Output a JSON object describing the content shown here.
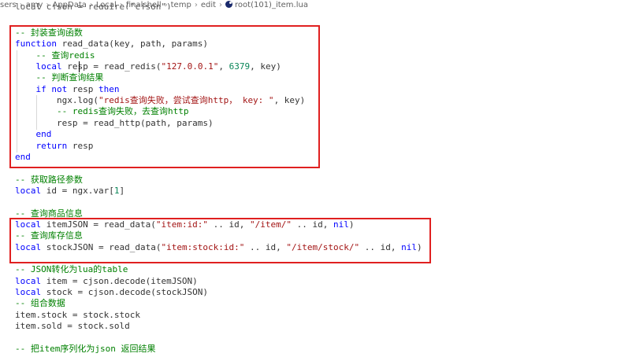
{
  "breadcrumb": {
    "items": [
      "sers",
      "amy",
      "AppData",
      "Local",
      "finalshell",
      "temp",
      "edit",
      "root(101)_item.lua"
    ],
    "file_icon": "lua-file-icon"
  },
  "editor": {
    "partial_top_line": "local cjson = require(\"cjson\")",
    "lines": [
      {
        "segments": [
          {
            "t": "-- 封装查询函数",
            "c": "c"
          }
        ]
      },
      {
        "segments": [
          {
            "t": "function",
            "c": "k"
          },
          {
            "t": " read_data(key, path, params)",
            "c": "p"
          }
        ]
      },
      {
        "segments": [
          {
            "t": "    -- 查询redis",
            "c": "c"
          }
        ]
      },
      {
        "segments": [
          {
            "t": "    ",
            "c": "p"
          },
          {
            "t": "local",
            "c": "k"
          },
          {
            "t": " resp = read_redis(",
            "c": "p"
          },
          {
            "t": "\"127.0.0.1\"",
            "c": "s"
          },
          {
            "t": ", ",
            "c": "p"
          },
          {
            "t": "6379",
            "c": "n"
          },
          {
            "t": ", key)",
            "c": "p"
          }
        ]
      },
      {
        "segments": [
          {
            "t": "    -- 判断查询结果",
            "c": "c"
          }
        ]
      },
      {
        "segments": [
          {
            "t": "    ",
            "c": "p"
          },
          {
            "t": "if not",
            "c": "k"
          },
          {
            "t": " resp ",
            "c": "p"
          },
          {
            "t": "then",
            "c": "k"
          }
        ]
      },
      {
        "segments": [
          {
            "t": "        ngx.log(",
            "c": "p"
          },
          {
            "t": "\"redis查询失败，尝试查询http， key: \"",
            "c": "s"
          },
          {
            "t": ", key)",
            "c": "p"
          }
        ]
      },
      {
        "segments": [
          {
            "t": "        -- redis查询失败，去查询http",
            "c": "c"
          }
        ]
      },
      {
        "segments": [
          {
            "t": "        resp = read_http(path, params)",
            "c": "p"
          }
        ]
      },
      {
        "segments": [
          {
            "t": "    ",
            "c": "p"
          },
          {
            "t": "end",
            "c": "k"
          }
        ]
      },
      {
        "segments": [
          {
            "t": "    ",
            "c": "p"
          },
          {
            "t": "return",
            "c": "k"
          },
          {
            "t": " resp",
            "c": "p"
          }
        ]
      },
      {
        "segments": [
          {
            "t": "end",
            "c": "k"
          }
        ]
      },
      {
        "segments": []
      },
      {
        "segments": [
          {
            "t": "-- 获取路径参数",
            "c": "c"
          }
        ]
      },
      {
        "segments": [
          {
            "t": "local",
            "c": "k"
          },
          {
            "t": " id = ngx.var[",
            "c": "p"
          },
          {
            "t": "1",
            "c": "n"
          },
          {
            "t": "]",
            "c": "p"
          }
        ]
      },
      {
        "segments": []
      },
      {
        "segments": [
          {
            "t": "-- 查询商品信息",
            "c": "c"
          }
        ]
      },
      {
        "segments": [
          {
            "t": "local",
            "c": "k"
          },
          {
            "t": " itemJSON = read_data(",
            "c": "p"
          },
          {
            "t": "\"item:id:\"",
            "c": "s"
          },
          {
            "t": " .. id, ",
            "c": "p"
          },
          {
            "t": "\"/item/\"",
            "c": "s"
          },
          {
            "t": " .. id, ",
            "c": "p"
          },
          {
            "t": "nil",
            "c": "k"
          },
          {
            "t": ")",
            "c": "p"
          }
        ]
      },
      {
        "segments": [
          {
            "t": "-- 查询库存信息",
            "c": "c"
          }
        ]
      },
      {
        "segments": [
          {
            "t": "local",
            "c": "k"
          },
          {
            "t": " stockJSON = read_data(",
            "c": "p"
          },
          {
            "t": "\"item:stock:id:\"",
            "c": "s"
          },
          {
            "t": " .. id, ",
            "c": "p"
          },
          {
            "t": "\"/item/stock/\"",
            "c": "s"
          },
          {
            "t": " .. id, ",
            "c": "p"
          },
          {
            "t": "nil",
            "c": "k"
          },
          {
            "t": ")",
            "c": "p"
          }
        ]
      },
      {
        "segments": []
      },
      {
        "segments": [
          {
            "t": "-- JSON转化为lua的table",
            "c": "c"
          }
        ]
      },
      {
        "segments": [
          {
            "t": "local",
            "c": "k"
          },
          {
            "t": " item = cjson.decode(itemJSON)",
            "c": "p"
          }
        ]
      },
      {
        "segments": [
          {
            "t": "local",
            "c": "k"
          },
          {
            "t": " stock = cjson.decode(stockJSON)",
            "c": "p"
          }
        ]
      },
      {
        "segments": [
          {
            "t": "-- 组合数据",
            "c": "c"
          }
        ]
      },
      {
        "segments": [
          {
            "t": "item.stock = stock.stock",
            "c": "p"
          }
        ]
      },
      {
        "segments": [
          {
            "t": "item.sold = stock.sold",
            "c": "p"
          }
        ]
      },
      {
        "segments": []
      },
      {
        "segments": [
          {
            "t": "-- 把item序列化为json 返回结果",
            "c": "c"
          }
        ]
      }
    ]
  },
  "colors": {
    "keyword": "#0000ff",
    "comment": "#008000",
    "string": "#a31515",
    "number": "#098658",
    "highlight_box": "#e02020"
  }
}
